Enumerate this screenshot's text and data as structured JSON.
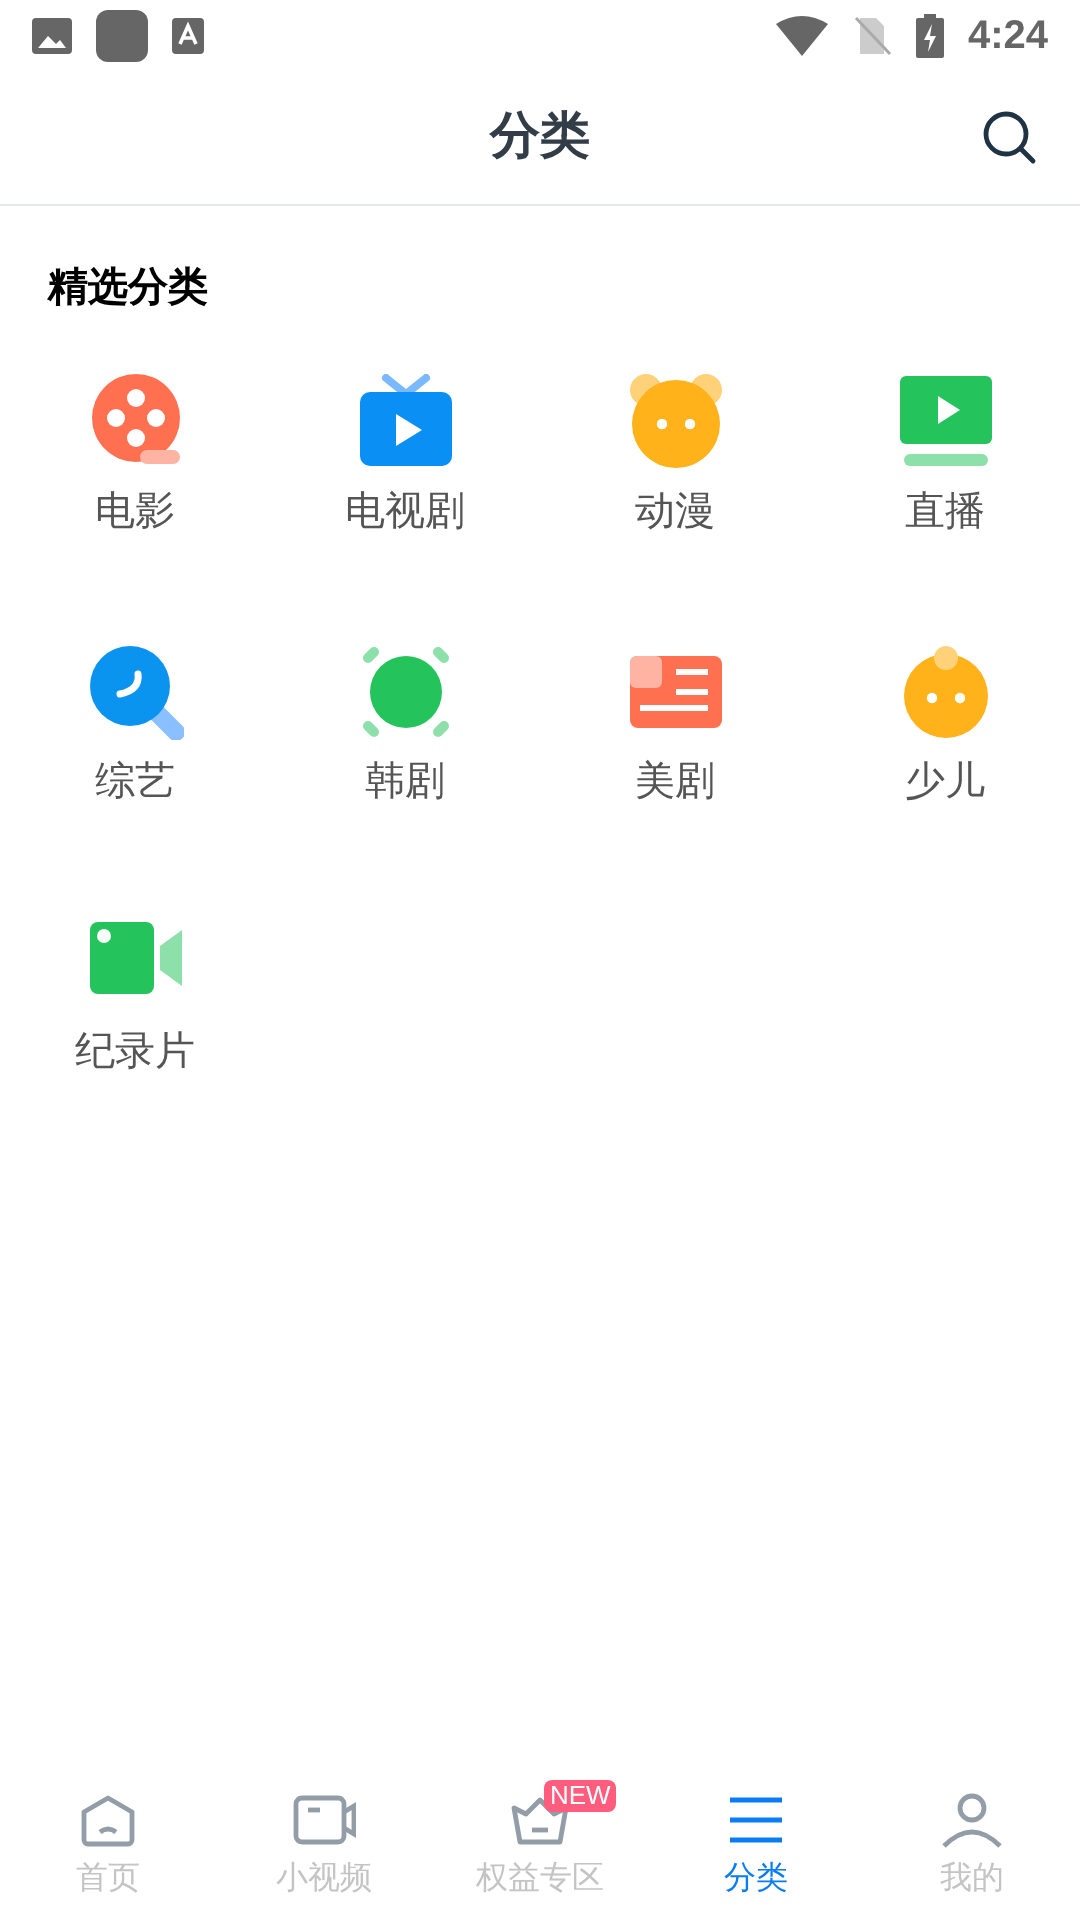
{
  "status_bar": {
    "time": "4:24"
  },
  "header": {
    "title": "分类"
  },
  "section": {
    "title": "精选分类"
  },
  "categories": [
    {
      "label": "电影",
      "kind": "film"
    },
    {
      "label": "电视剧",
      "kind": "tv"
    },
    {
      "label": "动漫",
      "kind": "bear"
    },
    {
      "label": "直播",
      "kind": "live"
    },
    {
      "label": "综艺",
      "kind": "mic"
    },
    {
      "label": "韩剧",
      "kind": "korea"
    },
    {
      "label": "美剧",
      "kind": "news"
    },
    {
      "label": "少儿",
      "kind": "kid"
    },
    {
      "label": "纪录片",
      "kind": "video"
    }
  ],
  "bottom_nav": [
    {
      "label": "首页",
      "kind": "home",
      "selected": false
    },
    {
      "label": "小视频",
      "kind": "camera",
      "selected": false
    },
    {
      "label": "权益专区",
      "kind": "basket",
      "selected": false,
      "badge": "NEW"
    },
    {
      "label": "分类",
      "kind": "menu",
      "selected": true
    },
    {
      "label": "我的",
      "kind": "user",
      "selected": false
    }
  ]
}
